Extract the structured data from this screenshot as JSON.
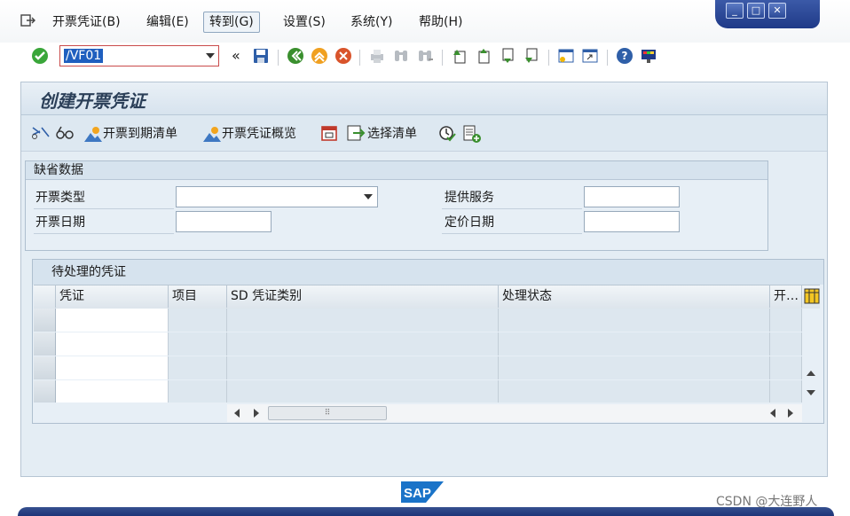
{
  "menu": {
    "items": [
      "开票凭证(B)",
      "编辑(E)",
      "转到(G)",
      "设置(S)",
      "系统(Y)",
      "帮助(H)"
    ],
    "active_index": 2
  },
  "window_controls": [
    "minimize-icon",
    "maximize-icon",
    "close-icon"
  ],
  "toolbar": {
    "command_value": "/VF01",
    "collapse_glyph": "«"
  },
  "screen": {
    "title": "创建开票凭证",
    "app_toolbar": [
      {
        "icon": "cut-icon",
        "label": ""
      },
      {
        "icon": "glasses-icon",
        "label": ""
      },
      {
        "icon": "mountain-icon",
        "label": "开票到期清单"
      },
      {
        "icon": "mountain-icon",
        "label": "开票凭证概览"
      },
      {
        "icon": "calendar-icon",
        "label": ""
      },
      {
        "icon": "export-icon",
        "label": "选择清单"
      },
      {
        "icon": "clock-check-icon",
        "label": ""
      },
      {
        "icon": "add-list-icon",
        "label": ""
      }
    ]
  },
  "defaults": {
    "header": "缺省数据",
    "billing_type_label": "开票类型",
    "billing_date_label": "开票日期",
    "service_label": "提供服务",
    "pricing_date_label": "定价日期",
    "billing_type_value": "",
    "billing_date_value": "",
    "service_value": "",
    "pricing_date_value": ""
  },
  "pending": {
    "header": "待处理的凭证",
    "columns": [
      "凭证",
      "项目",
      "SD 凭证类别",
      "处理状态",
      "开…"
    ],
    "rows": [
      [
        "",
        "",
        "",
        "",
        ""
      ],
      [
        "",
        "",
        "",
        "",
        ""
      ],
      [
        "",
        "",
        "",
        "",
        ""
      ],
      [
        "",
        "",
        "",
        "",
        ""
      ]
    ]
  },
  "status": {
    "brand": "SAP",
    "watermark": "CSDN @大连野人"
  },
  "colors": {
    "accent": "#1f5fbf",
    "frame_bg": "#e4edf4",
    "window_bar": "#2b4a98"
  }
}
